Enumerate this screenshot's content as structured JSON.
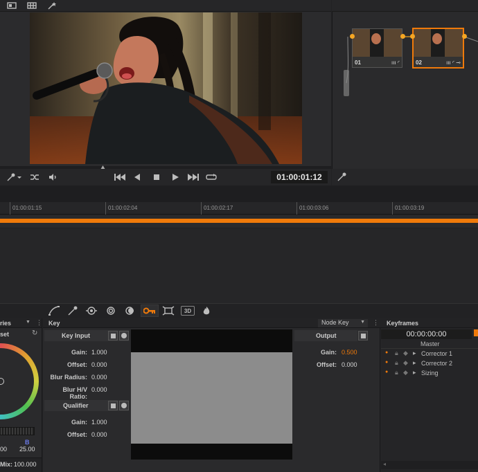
{
  "viewer": {
    "timecode": "01:00:01:12"
  },
  "nodes": [
    {
      "label": "01"
    },
    {
      "label": "02"
    }
  ],
  "timeline": {
    "ticks": [
      "01:00:01:15",
      "01:00:02:04",
      "01:00:02:17",
      "01:00:03:06",
      "01:00:03:19"
    ]
  },
  "palette_tabs": {
    "3d_label": "3D"
  },
  "left_panel": {
    "title": "ries",
    "subtitle": "set",
    "b_label": "B",
    "val_left": "00",
    "val_right": "25.00",
    "mix_label": "Mix:",
    "mix_value": "100.000"
  },
  "key": {
    "title": "Key",
    "node_key_label": "Node Key",
    "key_input_label": "Key Input",
    "output_label": "Output",
    "qualifier_label": "Qualifier",
    "input_params": [
      {
        "label": "Gain:",
        "value": "1.000"
      },
      {
        "label": "Offset:",
        "value": "0.000"
      },
      {
        "label": "Blur Radius:",
        "value": "0.000"
      },
      {
        "label": "Blur H/V Ratio:",
        "value": "0.000"
      }
    ],
    "output_params": [
      {
        "label": "Gain:",
        "value": "0.500"
      },
      {
        "label": "Offset:",
        "value": "0.000"
      }
    ],
    "qualifier_params": [
      {
        "label": "Gain:",
        "value": "1.000"
      },
      {
        "label": "Offset:",
        "value": "0.000"
      }
    ]
  },
  "keyframes": {
    "title": "Keyframes",
    "timecode": "00:00:00:00",
    "master": "Master",
    "rows": [
      "Corrector 1",
      "Corrector 2",
      "Sizing"
    ]
  },
  "colors": {
    "accent": "#f07a0a",
    "node_highlight": "#f5a623",
    "output_gain": "#f07a0a"
  }
}
